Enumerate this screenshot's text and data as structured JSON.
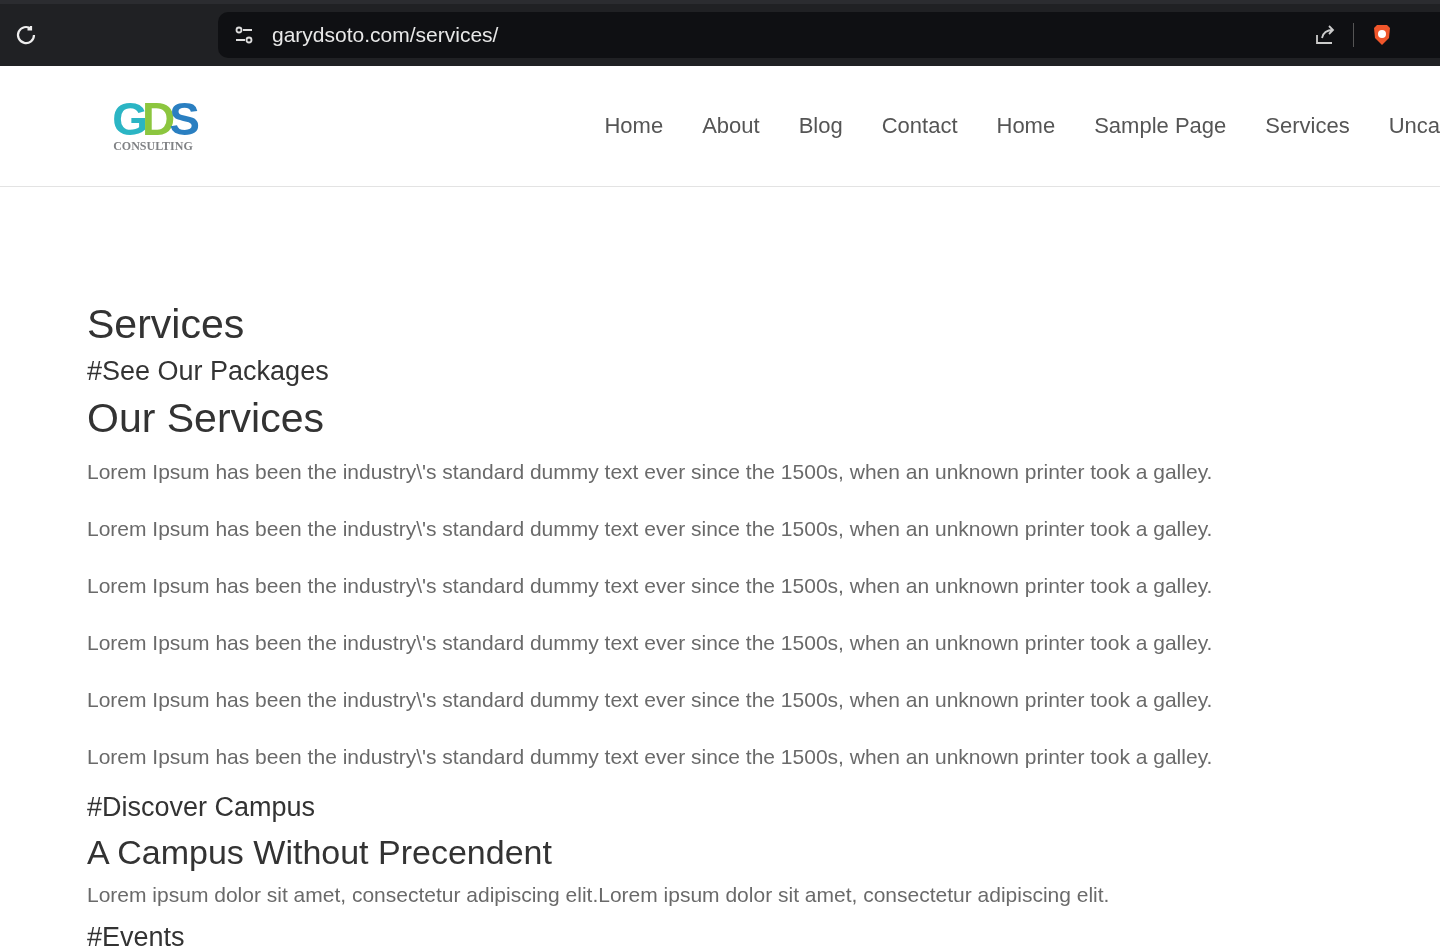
{
  "browser": {
    "address": "garydsoto.com/services/"
  },
  "logo": {
    "letters": [
      {
        "text": "G",
        "color": "#2bb5c4"
      },
      {
        "text": "D",
        "color": "#8cc63f"
      },
      {
        "text": "S",
        "color": "#2a7fc1"
      }
    ],
    "subtitle": "CONSULTING"
  },
  "nav": [
    "Home",
    "About",
    "Blog",
    "Contact",
    "Home",
    "Sample Page",
    "Services",
    "Unca"
  ],
  "content": [
    {
      "kind": "title",
      "text": "Services"
    },
    {
      "kind": "tag",
      "text": "#See Our Packages"
    },
    {
      "kind": "title",
      "text": "Our Services"
    },
    {
      "kind": "para",
      "text": "Lorem Ipsum has been the industry\\'s standard dummy text ever since the 1500s, when an unknown printer took a galley."
    },
    {
      "kind": "para",
      "text": "Lorem Ipsum has been the industry\\'s standard dummy text ever since the 1500s, when an unknown printer took a galley."
    },
    {
      "kind": "para",
      "text": "Lorem Ipsum has been the industry\\'s standard dummy text ever since the 1500s, when an unknown printer took a galley."
    },
    {
      "kind": "para",
      "text": "Lorem Ipsum has been the industry\\'s standard dummy text ever since the 1500s, when an unknown printer took a galley."
    },
    {
      "kind": "para",
      "text": "Lorem Ipsum has been the industry\\'s standard dummy text ever since the 1500s, when an unknown printer took a galley."
    },
    {
      "kind": "para",
      "text": "Lorem Ipsum has been the industry\\'s standard dummy text ever since the 1500s, when an unknown printer took a galley."
    },
    {
      "kind": "tag",
      "text": "#Discover Campus"
    },
    {
      "kind": "subtitle",
      "text": "A Campus Without Precendent"
    },
    {
      "kind": "plain",
      "text": "Lorem ipsum dolor sit amet, consectetur adipiscing elit.Lorem ipsum dolor sit amet, consectetur adipiscing elit."
    },
    {
      "kind": "tag",
      "text": "#Events"
    }
  ]
}
